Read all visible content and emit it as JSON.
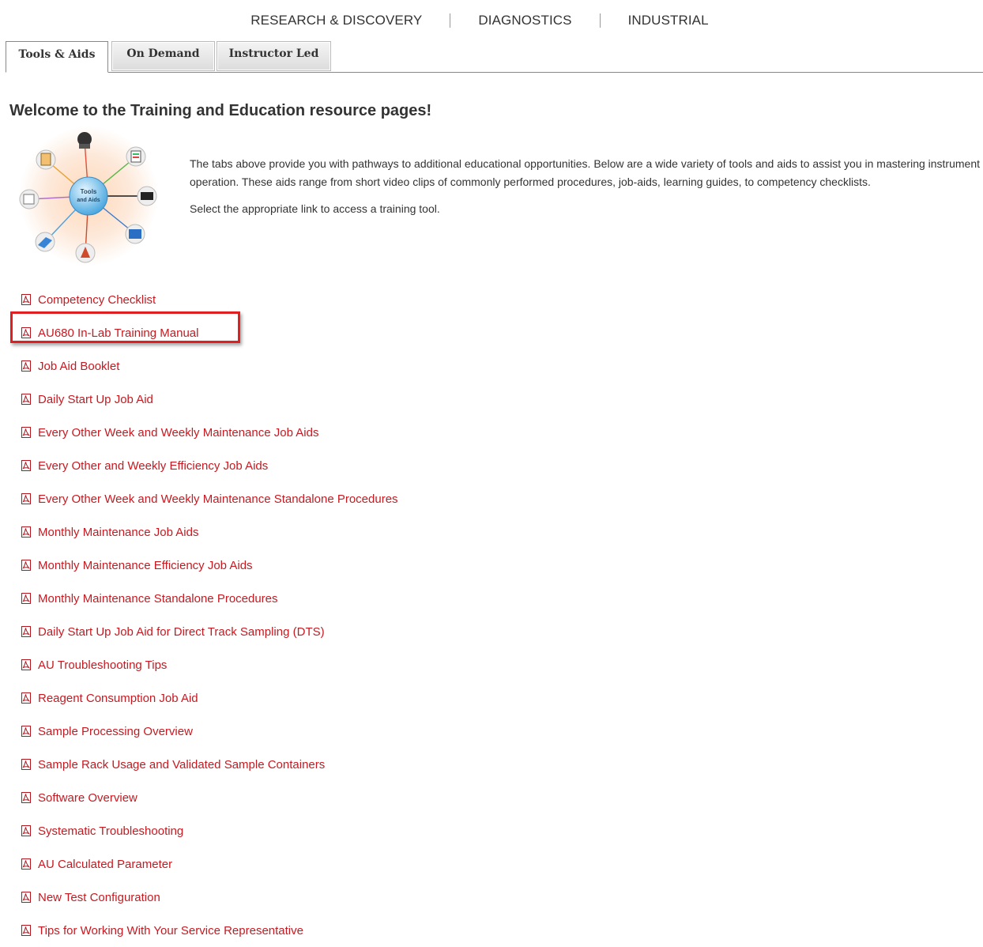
{
  "topnav": {
    "items": [
      "RESEARCH & DISCOVERY",
      "DIAGNOSTICS",
      "INDUSTRIAL"
    ]
  },
  "tabs": [
    "Tools & Aids",
    "On Demand",
    "Instructor Led"
  ],
  "page_title": "Welcome to the Training and Education resource pages!",
  "hero": {
    "label_line1": "Tools",
    "label_line2": "and Aids"
  },
  "intro": {
    "paragraph1": "The tabs above provide you with pathways to additional educational opportunities. Below are a wide variety of tools and aids to assist you in mastering instrument operation. These aids range from short video clips of commonly performed procedures, job-aids, learning guides, to competency checklists.",
    "paragraph2": "Select the appropriate link to access a training tool."
  },
  "links": [
    "Competency Checklist",
    "AU680 In-Lab Training Manual",
    "Job Aid Booklet",
    "Daily Start Up Job Aid",
    "Every Other Week and Weekly Maintenance Job Aids",
    "Every Other and Weekly Efficiency Job Aids",
    "Every Other Week and Weekly Maintenance Standalone Procedures",
    "Monthly Maintenance Job Aids",
    "Monthly Maintenance Efficiency Job Aids",
    "Monthly Maintenance Standalone Procedures",
    "Daily Start Up Job Aid for Direct Track Sampling (DTS)",
    "AU Troubleshooting Tips",
    "Reagent Consumption Job Aid",
    "Sample Processing Overview",
    "Sample Rack Usage and Validated Sample Containers",
    "Software Overview",
    "Systematic Troubleshooting",
    "AU Calculated Parameter",
    "New Test Configuration",
    "Tips for Working With Your Service Representative"
  ],
  "colors": {
    "link": "#c51a21",
    "highlight": "#e02020",
    "hub": "#7cc4ef"
  }
}
